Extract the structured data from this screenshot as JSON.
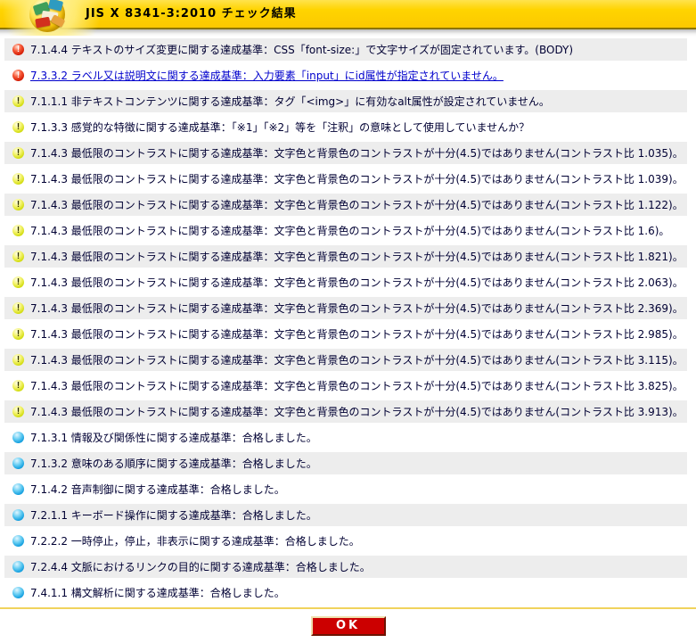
{
  "header": {
    "title": "JIS X 8341-3:2010 チェック結果",
    "logo_icon": "checker-app-logo-icon"
  },
  "colors": {
    "header_yellow": "#ffd400",
    "row_stripe_gray": "#ededed",
    "error_red": "#cf1500",
    "warning_yellow": "#ccd800",
    "pass_blue": "#0094da",
    "link_blue": "#0000cc",
    "ok_button_red": "#cc0000",
    "divider_gold": "#f0d35c"
  },
  "results": [
    {
      "status": "error",
      "icon": "error-ball-icon",
      "link": false,
      "text": "7.1.4.4 テキストのサイズ変更に関する達成基準：CSS「font-size:」で文字サイズが固定されています。(BODY)"
    },
    {
      "status": "error",
      "icon": "error-ball-icon",
      "link": true,
      "text": "7.3.3.2 ラベル又は説明文に関する達成基準：入力要素「input」にid属性が指定されていません。"
    },
    {
      "status": "warning",
      "icon": "warning-ball-icon",
      "link": false,
      "text": "7.1.1.1 非テキストコンテンツに関する達成基準：タグ「<img>」に有効なalt属性が設定されていません。"
    },
    {
      "status": "warning",
      "icon": "warning-ball-icon",
      "link": false,
      "text": "7.1.3.3 感覚的な特徴に関する達成基準：「※1」「※2」等を「注釈」の意味として使用していませんか？"
    },
    {
      "status": "warning",
      "icon": "warning-ball-icon",
      "link": false,
      "text": "7.1.4.3 最低限のコントラストに関する達成基準：文字色と背景色のコントラストが十分(4.5)ではありません(コントラスト比 1.035)。"
    },
    {
      "status": "warning",
      "icon": "warning-ball-icon",
      "link": false,
      "text": "7.1.4.3 最低限のコントラストに関する達成基準：文字色と背景色のコントラストが十分(4.5)ではありません(コントラスト比 1.039)。"
    },
    {
      "status": "warning",
      "icon": "warning-ball-icon",
      "link": false,
      "text": "7.1.4.3 最低限のコントラストに関する達成基準：文字色と背景色のコントラストが十分(4.5)ではありません(コントラスト比 1.122)。"
    },
    {
      "status": "warning",
      "icon": "warning-ball-icon",
      "link": false,
      "text": "7.1.4.3 最低限のコントラストに関する達成基準：文字色と背景色のコントラストが十分(4.5)ではありません(コントラスト比 1.6)。"
    },
    {
      "status": "warning",
      "icon": "warning-ball-icon",
      "link": false,
      "text": "7.1.4.3 最低限のコントラストに関する達成基準：文字色と背景色のコントラストが十分(4.5)ではありません(コントラスト比 1.821)。"
    },
    {
      "status": "warning",
      "icon": "warning-ball-icon",
      "link": false,
      "text": "7.1.4.3 最低限のコントラストに関する達成基準：文字色と背景色のコントラストが十分(4.5)ではありません(コントラスト比 2.063)。"
    },
    {
      "status": "warning",
      "icon": "warning-ball-icon",
      "link": false,
      "text": "7.1.4.3 最低限のコントラストに関する達成基準：文字色と背景色のコントラストが十分(4.5)ではありません(コントラスト比 2.369)。"
    },
    {
      "status": "warning",
      "icon": "warning-ball-icon",
      "link": false,
      "text": "7.1.4.3 最低限のコントラストに関する達成基準：文字色と背景色のコントラストが十分(4.5)ではありません(コントラスト比 2.985)。"
    },
    {
      "status": "warning",
      "icon": "warning-ball-icon",
      "link": false,
      "text": "7.1.4.3 最低限のコントラストに関する達成基準：文字色と背景色のコントラストが十分(4.5)ではありません(コントラスト比 3.115)。"
    },
    {
      "status": "warning",
      "icon": "warning-ball-icon",
      "link": false,
      "text": "7.1.4.3 最低限のコントラストに関する達成基準：文字色と背景色のコントラストが十分(4.5)ではありません(コントラスト比 3.825)。"
    },
    {
      "status": "warning",
      "icon": "warning-ball-icon",
      "link": false,
      "text": "7.1.4.3 最低限のコントラストに関する達成基準：文字色と背景色のコントラストが十分(4.5)ではありません(コントラスト比 3.913)。"
    },
    {
      "status": "pass",
      "icon": "pass-ball-icon",
      "link": false,
      "text": "7.1.3.1 情報及び関係性に関する達成基準：合格しました。"
    },
    {
      "status": "pass",
      "icon": "pass-ball-icon",
      "link": false,
      "text": "7.1.3.2 意味のある順序に関する達成基準：合格しました。"
    },
    {
      "status": "pass",
      "icon": "pass-ball-icon",
      "link": false,
      "text": "7.1.4.2 音声制御に関する達成基準：合格しました。"
    },
    {
      "status": "pass",
      "icon": "pass-ball-icon",
      "link": false,
      "text": "7.2.1.1 キーボード操作に関する達成基準：合格しました。"
    },
    {
      "status": "pass",
      "icon": "pass-ball-icon",
      "link": false,
      "text": "7.2.2.2 一時停止，停止，非表示に関する達成基準：合格しました。"
    },
    {
      "status": "pass",
      "icon": "pass-ball-icon",
      "link": false,
      "text": "7.2.4.4 文脈におけるリンクの目的に関する達成基準：合格しました。"
    },
    {
      "status": "pass",
      "icon": "pass-ball-icon",
      "link": false,
      "text": "7.4.1.1 構文解析に関する達成基準：合格しました。"
    }
  ],
  "footer": {
    "ok_label": "OK"
  }
}
